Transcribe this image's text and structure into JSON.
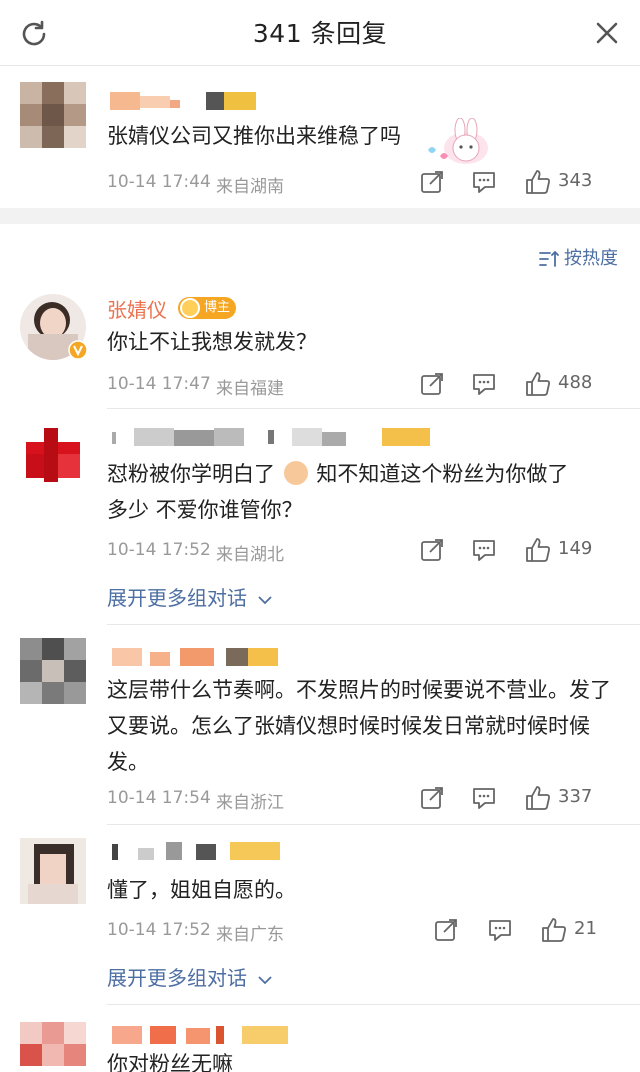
{
  "header": {
    "title": "341 条回复"
  },
  "top_comment": {
    "text": "张婧仪公司又推你出来维稳了吗",
    "time": "10-14 17:44",
    "location": "来自湖南",
    "likes": "343"
  },
  "sort_label": "按热度",
  "comments": [
    {
      "name": "张婧仪",
      "badge": "博主",
      "text": "你让不让我想发就发？",
      "time": "10-14 17:47",
      "location": "来自福建",
      "likes": "488"
    },
    {
      "text_1": "怼粉被你学明白了",
      "text_2": "知不知道这个粉丝为你做了",
      "text_3": "多少 不爱你谁管你？",
      "time": "10-14 17:52",
      "location": "来自湖北",
      "likes": "149",
      "expand": "展开更多组对话"
    },
    {
      "text": "这层带什么节奏啊。不发照片的时候要说不营业。发了又要说。怎么了张婧仪想时候时候发日常就时候时候发。",
      "time": "10-14 17:54",
      "location": "来自浙江",
      "likes": "337"
    },
    {
      "text": "懂了，姐姐自愿的。",
      "time": "10-14 17:52",
      "location": "来自广东",
      "likes": "21",
      "expand": "展开更多组对话"
    },
    {
      "text": "你对粉丝无嘛"
    }
  ],
  "icons": {
    "refresh": "refresh-icon",
    "close": "close-icon",
    "share": "share-icon",
    "reply": "comment-icon",
    "like": "like-icon",
    "sort": "sort-icon",
    "chevron": "chevron-down-icon",
    "fist": "fist-emoji-icon",
    "sticker": "bunny-sticker-icon",
    "verified": "verified-badge-icon"
  },
  "colors": {
    "accent_name": "#eb7350",
    "link": "#4e6fa3",
    "meta": "#999999",
    "badge": "#f5a623"
  }
}
